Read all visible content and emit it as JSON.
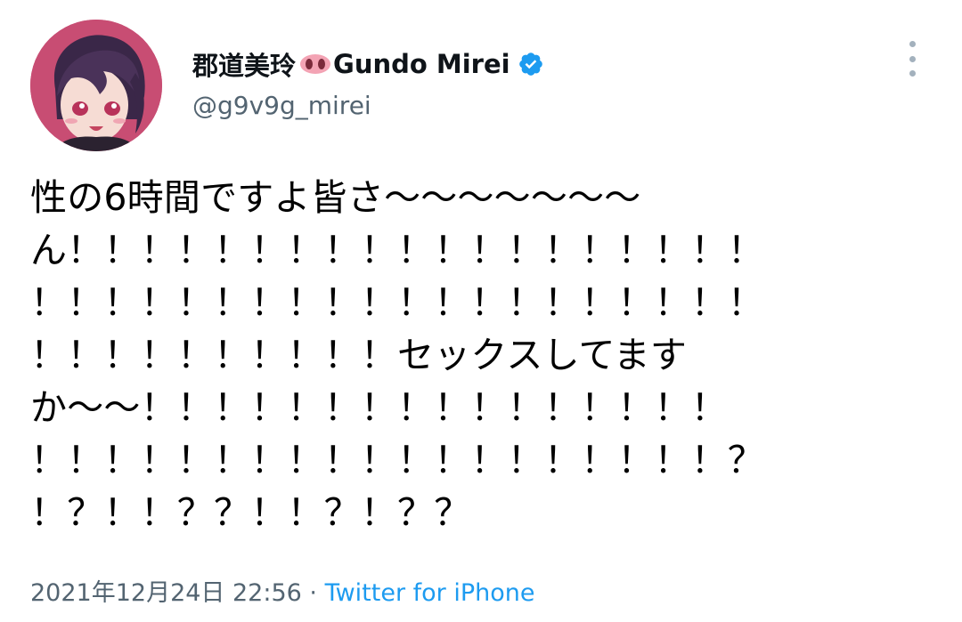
{
  "author": {
    "name_jp": "郡道美玲",
    "name_en": "Gundo Mirei",
    "emoji_icon": "pig-nose-icon",
    "verified": true,
    "handle": "@g9v9g_mirei"
  },
  "tweet": {
    "lines": [
      "性の6時間ですよ皆さ〜〜〜〜〜〜〜",
      "ん！！！！！！！！！！！！！！！！！！！",
      "！！！！！！！！！！！！！！！！！！！！",
      "！！！！！！！！！！セックスしてます",
      "か〜〜！！！！！！！！！！！！！！！！",
      "！！！！！！！！！！！！！！！！！！！？",
      "！？！！？？！！？！？？"
    ]
  },
  "meta": {
    "date": "2021年12月24日 22:56",
    "separator": " · ",
    "source": "Twitter for iPhone"
  },
  "colors": {
    "text": "#0f1419",
    "secondary": "#536471",
    "link": "#1d9bf0",
    "verified": "#1d9bf0",
    "avatar_bg": "#c84d73"
  }
}
